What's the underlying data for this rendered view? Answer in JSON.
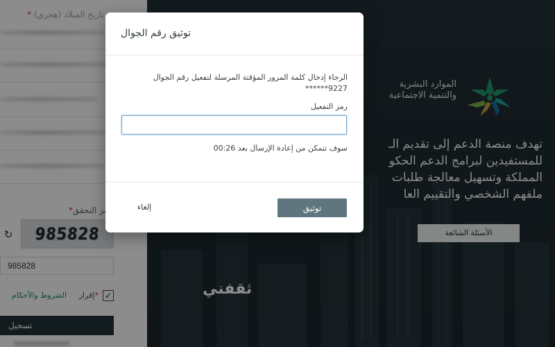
{
  "form": {
    "top_label": "تاريخ الميلاد (هجري)",
    "top_label_required": "*",
    "captcha_label": "رمز التحقق",
    "captcha_required": "*",
    "captcha_image_text": "985828",
    "captcha_input_value": "985828",
    "agree_required": "*",
    "agree_label": "إقرار",
    "terms_link": "الشروط والأحكام",
    "agree_checked": true,
    "register_label": "تسجيل"
  },
  "hero": {
    "logo_line1": "الموارد البشرية",
    "logo_line2": "والتنمية الاجتماعية",
    "text_lines": [
      "تهدف منصة الدعم إلى تقديم الـ",
      "للمستفيدين لبرامج الدعم الحكو",
      "المملكة وتسهيل معالجة طلبات",
      "ملفهم الشخصي والتقييم العا"
    ],
    "faq_label": "الأسئلة الشائعة",
    "watermark": "ثقفني"
  },
  "modal": {
    "title": "توثيق رقم الجوال",
    "message": "الرجاء إدخال كلمة المرور المؤقتة المرسلة لتفعيل رقم الجوال",
    "masked_phone": "******9227",
    "code_label": "رمز التفعيل",
    "code_value": "",
    "resend_text": "سوف تتمكن من إعادة الإرسال بعد 00:26",
    "verify_label": "توثيق",
    "cancel_label": "إلغاء"
  },
  "colors": {
    "primary_dark": "#223339",
    "verify_button": "#5f767e",
    "link_green": "#1c8a5a"
  }
}
